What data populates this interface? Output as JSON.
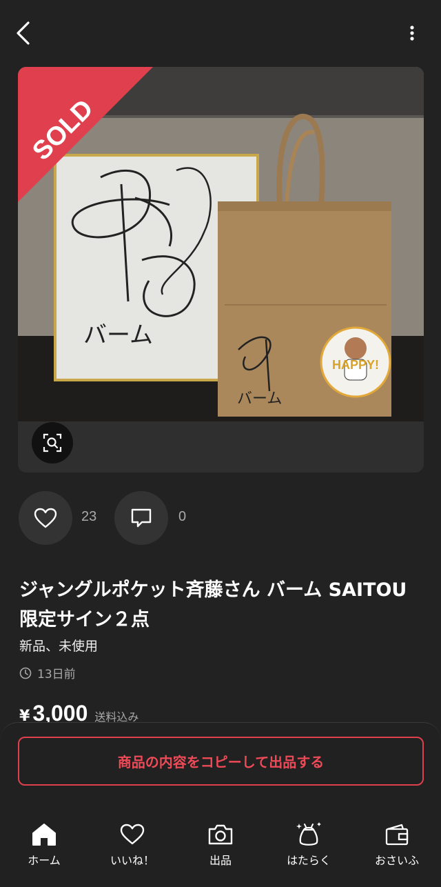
{
  "header": {
    "back_icon": "chevron-left-icon",
    "more_icon": "vertical-dots-icon"
  },
  "photo": {
    "sold_label": "SOLD",
    "sold_color": "#e0404e",
    "lens_icon": "image-search-icon",
    "handwriting_card": "バーム",
    "handwriting_bag": "バーム",
    "sticker_text": "HAPPY!"
  },
  "actions": {
    "likes": "23",
    "comments": "0"
  },
  "item": {
    "title": "ジャングルポケット斉藤さん バーム SAITOU 限定サイン２点",
    "condition": "新品、未使用",
    "posted": "13日前",
    "currency": "¥",
    "price": "3,000",
    "shipping": "送料込み"
  },
  "cta": {
    "copy_label": "商品の内容をコピーして出品する",
    "accent": "#ef4a57"
  },
  "tabs": [
    {
      "label": "ホーム",
      "icon": "home-icon"
    },
    {
      "label": "いいね！",
      "icon": "heart-icon"
    },
    {
      "label": "出品",
      "icon": "camera-icon"
    },
    {
      "label": "はたらく",
      "icon": "work-bag-icon"
    },
    {
      "label": "おさいふ",
      "icon": "wallet-icon"
    }
  ]
}
